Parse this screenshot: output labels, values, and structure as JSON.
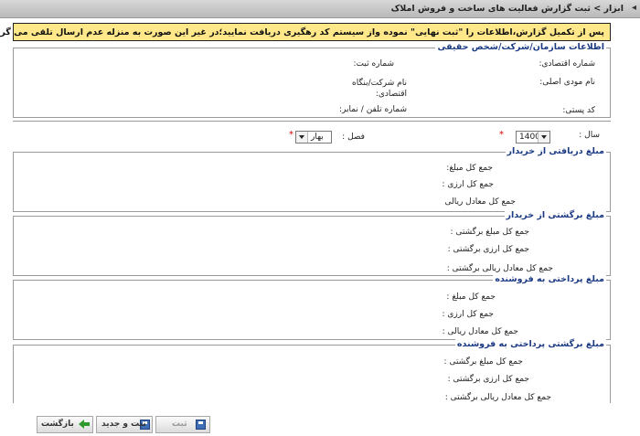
{
  "title": {
    "text": "ابزار > ثبت گزارش فعالیت های ساخت و فروش املاک"
  },
  "notice": "پس از تکمیل گزارش،اطلاعات را \"ثبت نهایی\" نموده واز سیستم کد رهگیری دریافت نمایید؛در غیر این صورت به منزله عدم ارسال تلقی می گردد!",
  "org": {
    "legend": "اطلاعات سازمان/شرکت/شخص حقیقی",
    "economic_code": "شماره اقتصادی:",
    "registration_no": "شماره ثبت:",
    "taxpayer_name": "نام مودی اصلی:",
    "company_name": "نام شرکت/بنگاه اقتصادی:",
    "postal_code": "کد پستی:",
    "phone_fax": "شماره تلفن / نمابر:"
  },
  "period": {
    "year_label": "سال :",
    "year_value": "1400",
    "season_label": "فصل :",
    "season_value": "بهار",
    "required_mark": "*"
  },
  "sections": {
    "received": {
      "legend": "مبلغ دریافتی از خریدار",
      "l1": "جمع کل مبلغ:",
      "l2": "جمع کل ارزی :",
      "l3": "جمع کل معادل ریالی"
    },
    "refund_buyer": {
      "legend": "مبلغ برگشتی از خریدار",
      "l1": "جمع کل مبلغ برگشتی :",
      "l2": "جمع کل ارزی برگشتی :",
      "l3": "جمع کل معادل ریالی برگشتی :"
    },
    "paid_seller": {
      "legend": "مبلغ پرداختی به فروشنده",
      "l1": "جمع کل مبلغ :",
      "l2": "جمع کل ارزی :",
      "l3": "جمع کل معادل ریالی :"
    },
    "refund_seller": {
      "legend": "مبلغ برگشتی پرداختی به فروشنده",
      "l1": "جمع کل مبلغ برگشتی :",
      "l2": "جمع کل ارزی برگشتی :",
      "l3": "جمع کل معادل ریالی برگشتی :"
    }
  },
  "buttons": {
    "save": "ثبت",
    "save_new": "ثبت و جدید",
    "back": "بازگشت"
  },
  "icons": {
    "save": "floppy-disk-icon",
    "save_new": "floppy-disk-icon",
    "back": "green-arrow-left-icon"
  },
  "colors": {
    "notice_bg": "#ffe88a",
    "legend_text": "#1b3a84"
  }
}
